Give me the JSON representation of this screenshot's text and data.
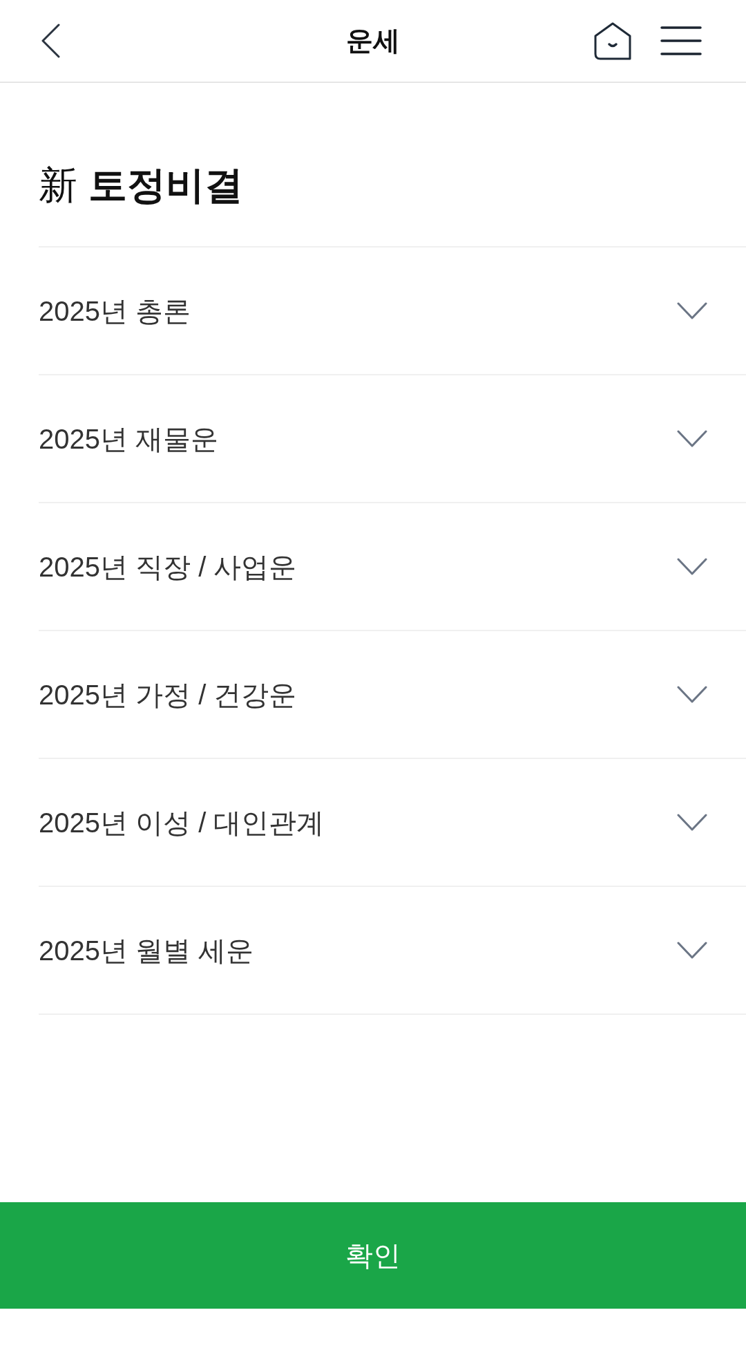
{
  "header": {
    "title": "운세"
  },
  "page_title": "新 **토정비결**",
  "sections": [
    {
      "label": "2025년 총론",
      "expanded": false
    },
    {
      "label": "2025년 재물운",
      "expanded": false
    },
    {
      "label": "2025년 직장 / 사업운",
      "expanded": false
    },
    {
      "label": "2025년 가정 / 건강운",
      "expanded": false
    },
    {
      "label": "2025년 이성 / 대인관계",
      "expanded": false
    },
    {
      "label": "2025년 월별 세운",
      "expanded": false
    }
  ],
  "confirm_button": {
    "label": "확인"
  }
}
